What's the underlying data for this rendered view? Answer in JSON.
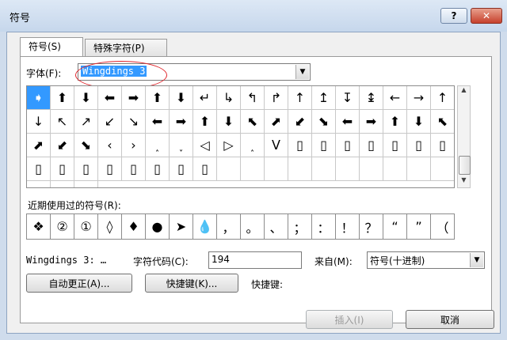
{
  "window": {
    "title": "符号",
    "help_label": "?",
    "close_label": "✕"
  },
  "tabs": [
    {
      "label": "符号(S)"
    },
    {
      "label": "特殊字符(P)"
    }
  ],
  "font": {
    "label": "字体(F):",
    "value": "Wingdings 3"
  },
  "symbol_grid": {
    "selected_index": 0,
    "cells": [
      "➧",
      "⬆",
      "⬇",
      "⬅",
      "➡",
      "⬆",
      "⬇",
      "↵",
      "↳",
      "↰",
      "↱",
      "↑",
      "↥",
      "↧",
      "↨",
      "←",
      "→",
      "↑",
      "↓",
      "↖",
      "↗",
      "↙",
      "↘",
      "⬅",
      "➡",
      "⬆",
      "⬇",
      "⬉",
      "⬈",
      "⬋",
      "⬊",
      "⬅",
      "➡",
      "⬆",
      "⬇",
      "⬉",
      "⬈",
      "⬋",
      "⬊",
      "‹",
      "›",
      "˰",
      "˯",
      "◁",
      "▷",
      "˰",
      "ᐯ",
      "▯",
      "▯",
      "▯",
      "▯",
      "▯",
      "▯",
      "▯",
      "▯",
      "▯",
      "▯",
      "▯",
      "▯",
      "▯",
      "▯",
      "▯",
      "",
      "",
      "",
      "",
      "",
      "",
      "",
      "",
      "",
      "",
      "",
      "",
      ""
    ]
  },
  "recent": {
    "label": "近期使用过的符号(R):",
    "symbols": [
      "❖",
      "②",
      "①",
      "◊",
      "♦",
      "●",
      "➤",
      "💧",
      "，",
      "。",
      "、",
      "；",
      "：",
      "！",
      "？",
      "“",
      "”",
      "（"
    ]
  },
  "info": {
    "font_name": "Wingdings 3: …",
    "char_code_label": "字符代码(C):",
    "char_code": "194",
    "from_label": "来自(M):",
    "from_value": "符号(十进制)"
  },
  "buttons": {
    "autocorrect": "自动更正(A)...",
    "shortcut_key": "快捷键(K)...",
    "shortcut_label": "快捷键:",
    "insert": "插入(I)",
    "cancel": "取消"
  }
}
